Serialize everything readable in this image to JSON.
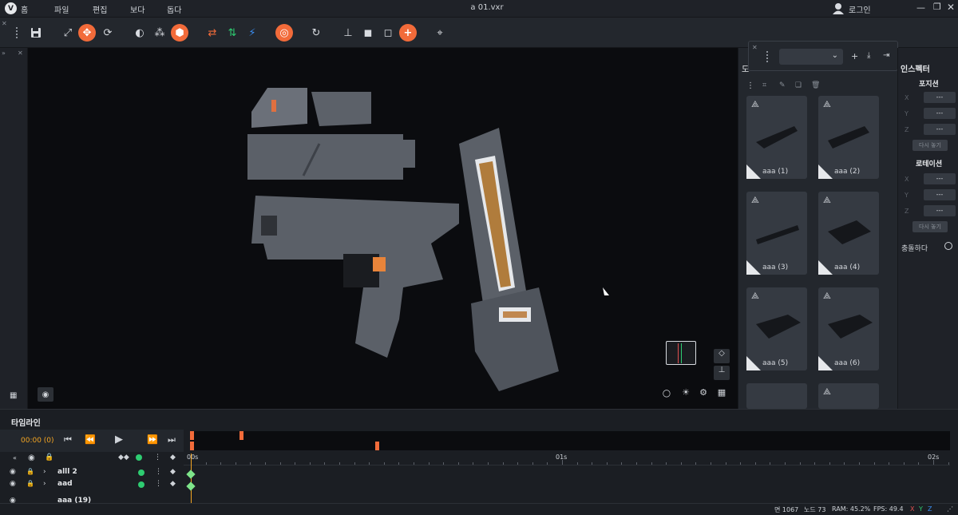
{
  "app": {
    "title": "a 01.vxr",
    "home_label": "홈",
    "login_label": "로그인"
  },
  "menu": [
    "파일",
    "편집",
    "보다",
    "돕다"
  ],
  "toolbar_icons": [
    "save-icon",
    "fit-icon",
    "move-icon",
    "rotate-icon",
    "material-icon",
    "hierarchy-icon",
    "cube-icon",
    "swap-icon",
    "flip-icon",
    "symmetry-icon",
    "target-icon",
    "refresh-icon",
    "tree-icon",
    "block-icon",
    "outline-icon",
    "add-icon",
    "crosshair-icon"
  ],
  "panel": {
    "tab_left": "도",
    "models": [
      {
        "label": "aaa (1)"
      },
      {
        "label": "aaa (2)"
      },
      {
        "label": "aaa (3)"
      },
      {
        "label": "aaa (4)"
      },
      {
        "label": "aaa (5)"
      },
      {
        "label": "aaa (6)"
      }
    ]
  },
  "inspector": {
    "title": "인스펙터",
    "position_label": "포지션",
    "rotation_label": "로테이션",
    "axes": [
      "X",
      "Y",
      "Z"
    ],
    "field_value": "---",
    "reset_label": "다시 놓기",
    "collision_label": "충돌하다"
  },
  "timeline": {
    "title": "타임라인",
    "time": "00:00 (0)",
    "ruler": [
      "00s",
      "01s",
      "02s"
    ],
    "tracks": [
      {
        "name": "alll 2"
      },
      {
        "name": "aad"
      },
      {
        "name": "aaa (19)"
      }
    ]
  },
  "status": {
    "faces": "면 1067",
    "nodes": "노드 73",
    "ram": "RAM: 45.2%",
    "fps": "FPS: 49.4",
    "axis_x": "X",
    "axis_y": "Y",
    "axis_z": "Z"
  },
  "colors": {
    "accent": "#f26b3a",
    "green": "#2ecc71"
  }
}
